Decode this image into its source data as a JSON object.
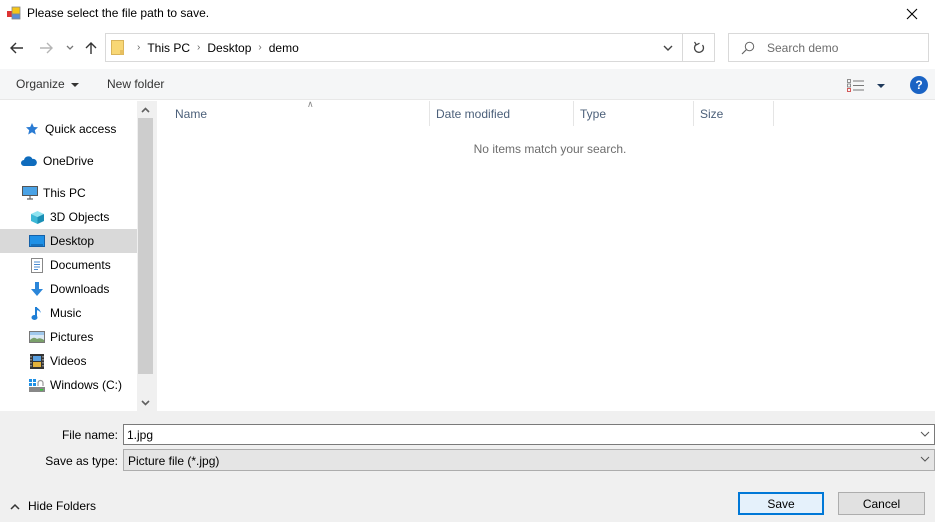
{
  "window": {
    "title": "Please select the file path to save.",
    "close_label": "Close"
  },
  "navigation": {
    "back_label": "Back",
    "forward_label": "Forward",
    "recent_label": "Recent locations",
    "up_label": "Up"
  },
  "address": {
    "breadcrumbs": [
      "This PC",
      "Desktop",
      "demo"
    ]
  },
  "search": {
    "placeholder": "Search demo",
    "value": ""
  },
  "toolbar": {
    "organize_label": "Organize",
    "new_folder_label": "New folder",
    "help_label": "?"
  },
  "sidebar": {
    "items": [
      {
        "label": "Quick access",
        "icon": "star-icon"
      },
      {
        "label": "OneDrive",
        "icon": "cloud-icon"
      },
      {
        "label": "This PC",
        "icon": "computer-icon"
      },
      {
        "label": "3D Objects",
        "icon": "cube-icon"
      },
      {
        "label": "Desktop",
        "icon": "desktop-icon",
        "selected": true
      },
      {
        "label": "Documents",
        "icon": "document-icon"
      },
      {
        "label": "Downloads",
        "icon": "download-icon"
      },
      {
        "label": "Music",
        "icon": "music-icon"
      },
      {
        "label": "Pictures",
        "icon": "picture-icon"
      },
      {
        "label": "Videos",
        "icon": "video-icon"
      },
      {
        "label": "Windows (C:)",
        "icon": "drive-icon"
      }
    ]
  },
  "filelist": {
    "columns": [
      "Name",
      "Date modified",
      "Type",
      "Size"
    ],
    "empty_message": "No items match your search."
  },
  "form": {
    "filename_label": "File name:",
    "filename_value": "1.jpg",
    "type_label": "Save as type:",
    "type_value": "Picture file (*.jpg)"
  },
  "footer": {
    "hide_folders_label": "Hide Folders",
    "save_label": "Save",
    "cancel_label": "Cancel"
  },
  "colors": {
    "accent": "#0078d7",
    "selection": "#d9d9d9",
    "help": "#1a63c4"
  }
}
